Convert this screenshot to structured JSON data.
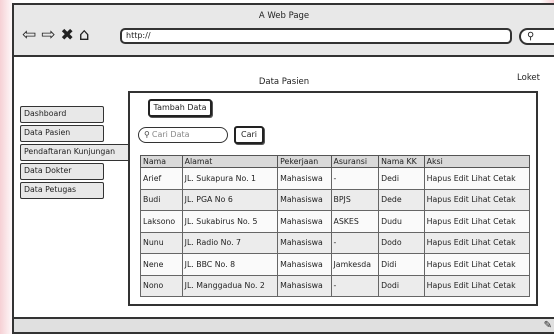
{
  "window": {
    "title": "A Web Page"
  },
  "browser": {
    "url": "http://",
    "icons": {
      "back": "back-arrow-icon",
      "forward": "forward-arrow-icon",
      "stop": "close-icon",
      "home": "home-icon",
      "search": "search-icon"
    }
  },
  "page": {
    "heading": "Data Pasien",
    "loket": "Loket"
  },
  "sidebar": {
    "items": [
      {
        "label": "Dashboard"
      },
      {
        "label": "Data Pasien"
      },
      {
        "label": "Pendaftaran Kunjungan"
      },
      {
        "label": "Data Dokter"
      },
      {
        "label": "Data Petugas"
      }
    ]
  },
  "toolbar": {
    "add_label": "Tambah Data",
    "search_placeholder": "Cari Data",
    "search_button": "Cari"
  },
  "table": {
    "headers": [
      "Nama",
      "Alamat",
      "Pekerjaan",
      "Asuransi",
      "Nama KK",
      "Aksi"
    ],
    "actions": [
      "Hapus",
      "Edit",
      "Lihat",
      "Cetak"
    ],
    "rows": [
      {
        "nama": "Arief",
        "alamat": "JL. Sukapura No. 1",
        "pekerjaan": "Mahasiswa",
        "asuransi": "-",
        "kk": "Dedi"
      },
      {
        "nama": "Budi",
        "alamat": "JL. PGA No 6",
        "pekerjaan": "Mahasiswa",
        "asuransi": "BPJS",
        "kk": "Dede"
      },
      {
        "nama": "Laksono",
        "alamat": "JL. Sukabirus No. 5",
        "pekerjaan": "Mahasiswa",
        "asuransi": "ASKES",
        "kk": "Dudu"
      },
      {
        "nama": "Nunu",
        "alamat": "JL. Radio No. 7",
        "pekerjaan": "Mahasiswa",
        "asuransi": "-",
        "kk": "Dodo"
      },
      {
        "nama": "Nene",
        "alamat": "JL. BBC No. 8",
        "pekerjaan": "Mahasiswa",
        "asuransi": "Jamkesda",
        "kk": "Didi"
      },
      {
        "nama": "Nono",
        "alamat": "JL. Manggadua No. 2",
        "pekerjaan": "Mahasiswa",
        "asuransi": "-",
        "kk": "Dodi"
      }
    ]
  }
}
